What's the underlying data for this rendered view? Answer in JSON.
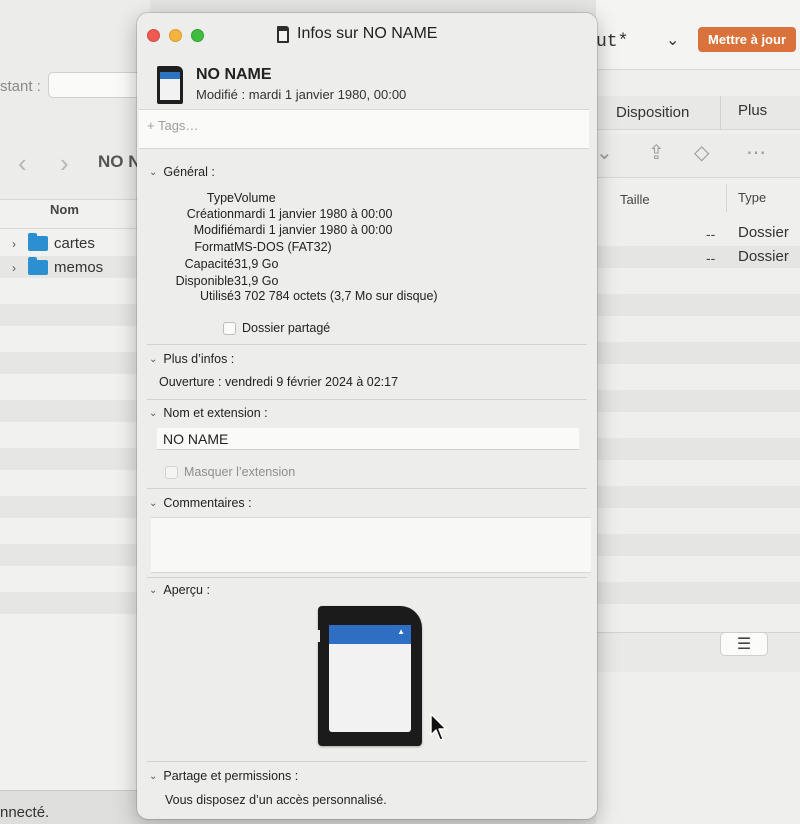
{
  "background_left": {
    "status_label": "stant :",
    "folder_title": "NO N",
    "column_header": "Nom",
    "rows": [
      {
        "name": "cartes"
      },
      {
        "name": "memos"
      }
    ],
    "status_bar": "nnecté."
  },
  "background_right": {
    "doc_title": "ut*",
    "update_button": "Mettre à jour",
    "menu": {
      "disposition": "Disposition",
      "plus": "Plus"
    },
    "columns": {
      "size": "Taille",
      "type": "Type"
    },
    "rows": [
      {
        "size": "--",
        "type": "Dossier"
      },
      {
        "size": "--",
        "type": "Dossier"
      }
    ]
  },
  "info_window": {
    "title": "Infos sur NO NAME",
    "item_name": "NO NAME",
    "item_modified": "Modifié : mardi 1 janvier 1980, 00:00",
    "tags_placeholder": "+ Tags…",
    "sections": {
      "general": "Général :",
      "more_info": "Plus d’infos :",
      "name_ext": "Nom et extension :",
      "comments": "Commentaires :",
      "preview": "Aperçu :",
      "sharing": "Partage et permissions :"
    },
    "general": [
      {
        "key": "Type",
        "value": "Volume"
      },
      {
        "key": "Création",
        "value": "mardi 1 janvier 1980 à 00:00"
      },
      {
        "key": "Modifié",
        "value": "mardi 1 janvier 1980 à 00:00"
      },
      {
        "key": "Format",
        "value": "MS-DOS (FAT32)"
      },
      {
        "key": "Capacité",
        "value": "31,9 Go"
      },
      {
        "key": "Disponible",
        "value": "31,9 Go"
      },
      {
        "key": "Utilisé",
        "value": "3 702 784 octets (3,7 Mo sur disque)"
      }
    ],
    "shared_folder_label": "Dossier partagé",
    "opened": "Ouverture : vendredi 9 février 2024 à 02:17",
    "name_value": "NO NAME",
    "hide_extension_label": "Masquer l’extension",
    "permissions_text": "Vous disposez d’un accès personnalisé."
  },
  "colors": {
    "update_button": "#d9733b",
    "close": "#ee5a52",
    "minimize": "#f3b33d",
    "maximize": "#3fbd3e",
    "folder_icon": "#2b8fd0",
    "sd_strip": "#2f6fc3"
  },
  "icons": [
    "sd-card-icon",
    "folder-icon",
    "chevron-right-icon",
    "chevron-down-icon",
    "share-icon",
    "tag-icon",
    "more-icon",
    "list-view-icon",
    "cursor-icon"
  ]
}
